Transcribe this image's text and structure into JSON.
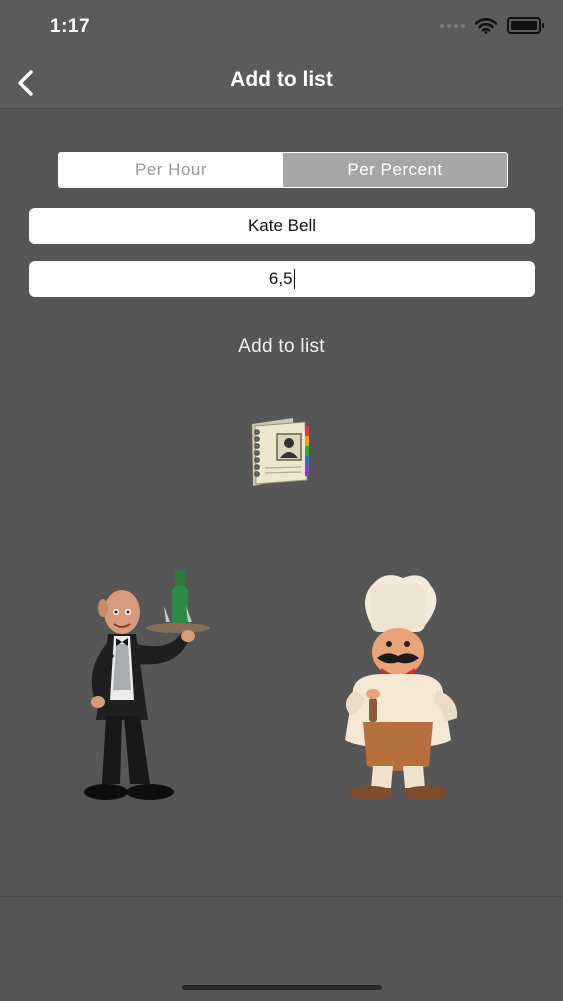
{
  "status": {
    "time": "1:17"
  },
  "nav": {
    "title": "Add to list"
  },
  "segments": [
    {
      "label": "Per Hour",
      "selected": false
    },
    {
      "label": "Per Percent",
      "selected": true
    }
  ],
  "form": {
    "name_value": "Kate Bell",
    "rate_value": "6,5"
  },
  "actions": {
    "add_label": "Add to list"
  },
  "icons": {
    "back": "chevron-left-icon",
    "wifi": "wifi-icon",
    "battery": "battery-icon",
    "contacts": "contacts-book-icon"
  },
  "images": {
    "waiter": "waiter-figurine",
    "chef": "chef-figurine"
  }
}
